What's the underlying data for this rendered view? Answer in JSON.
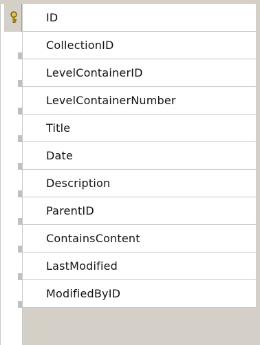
{
  "table": {
    "columns": [
      {
        "name": "ID",
        "is_primary_key": true
      },
      {
        "name": "CollectionID"
      },
      {
        "name": "LevelContainerID"
      },
      {
        "name": "LevelContainerNumber"
      },
      {
        "name": "Title"
      },
      {
        "name": "Date"
      },
      {
        "name": "Description"
      },
      {
        "name": "ParentID"
      },
      {
        "name": "ContainsContent"
      },
      {
        "name": "LastModified"
      },
      {
        "name": "ModifiedByID"
      }
    ]
  },
  "icons": {
    "primary_key": "key-icon"
  },
  "colors": {
    "frame_gray": "#d4d0c8",
    "grid_line": "#c8c8c8",
    "key_gold": "#e8c000"
  }
}
